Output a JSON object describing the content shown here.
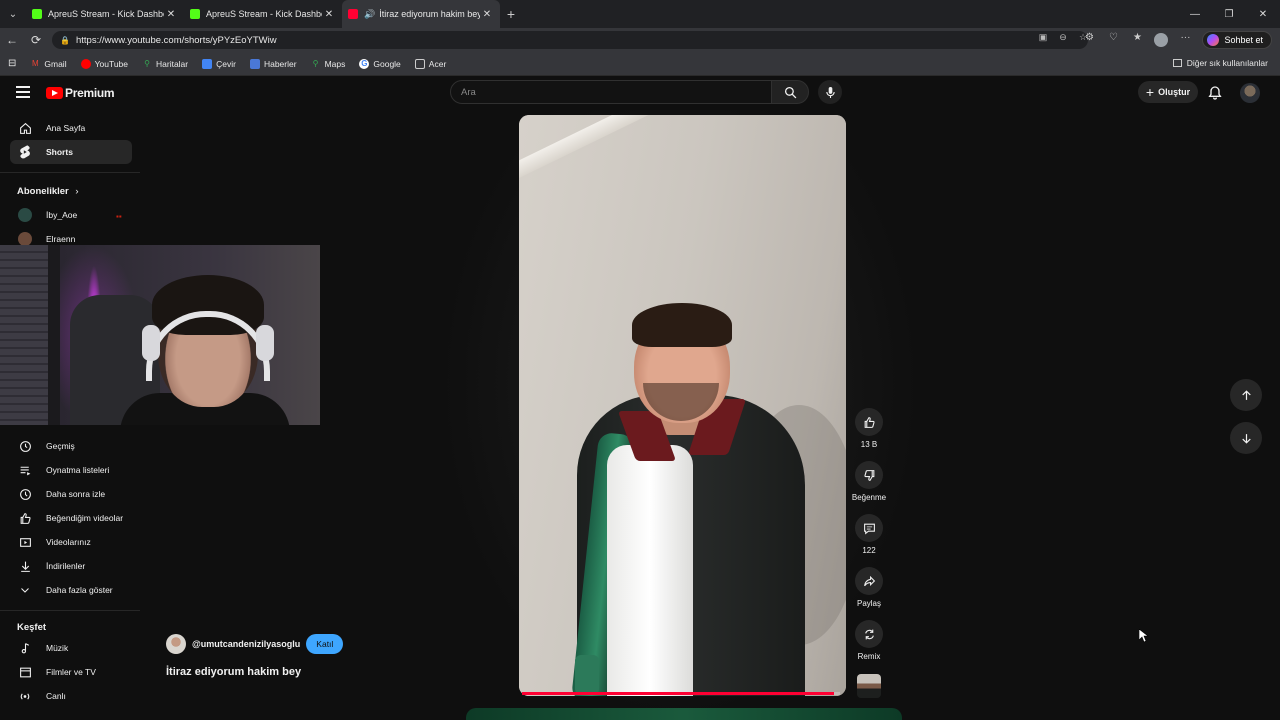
{
  "browser": {
    "tabs": [
      {
        "title": "ApreuS Stream - Kick Dashboard",
        "active": false,
        "favicon_color": "#53fc18"
      },
      {
        "title": "ApreuS Stream - Kick Dashboard",
        "active": false,
        "favicon_color": "#53fc18"
      },
      {
        "title": "İtiraz ediyorum hakim bey - Y",
        "active": true,
        "favicon_color": "#ff0033"
      }
    ],
    "url": "https://www.youtube.com/shorts/yPYzEoYTWiw",
    "copilot_label": "Sohbet et",
    "bookmarks": [
      "Gmail",
      "YouTube",
      "Haritalar",
      "Çevir",
      "Haberler",
      "Maps",
      "Google",
      "Acer"
    ],
    "other_bookmarks": "Diğer sık kullanılanlar"
  },
  "header": {
    "logo_text": "Premium",
    "search_placeholder": "Ara",
    "create_label": "Oluştur"
  },
  "sidebar": {
    "home": "Ana Sayfa",
    "shorts": "Shorts",
    "subscriptions_heading": "Abonelikler",
    "channels": [
      "İby_Aoe",
      "Elraenn"
    ],
    "library": [
      "Geçmiş",
      "Oynatma listeleri",
      "Daha sonra izle",
      "Beğendiğim videolar",
      "Videolarınız",
      "İndirilenler",
      "Daha fazla göster"
    ],
    "explore_heading": "Keşfet",
    "explore": [
      "Müzik",
      "Filmler ve TV",
      "Canlı"
    ]
  },
  "short": {
    "channel": "@umutcandenizilyasoglu",
    "join_label": "Katıl",
    "title": "İtiraz ediyorum hakim bey",
    "likes": "13 B",
    "dislike_label": "Beğenme",
    "comments": "122",
    "share_label": "Paylaş",
    "remix_label": "Remix",
    "progress": 0.98
  },
  "colors": {
    "accent_red": "#ff0033",
    "join_blue": "#3ea6ff",
    "background": "#0f0f0f"
  }
}
